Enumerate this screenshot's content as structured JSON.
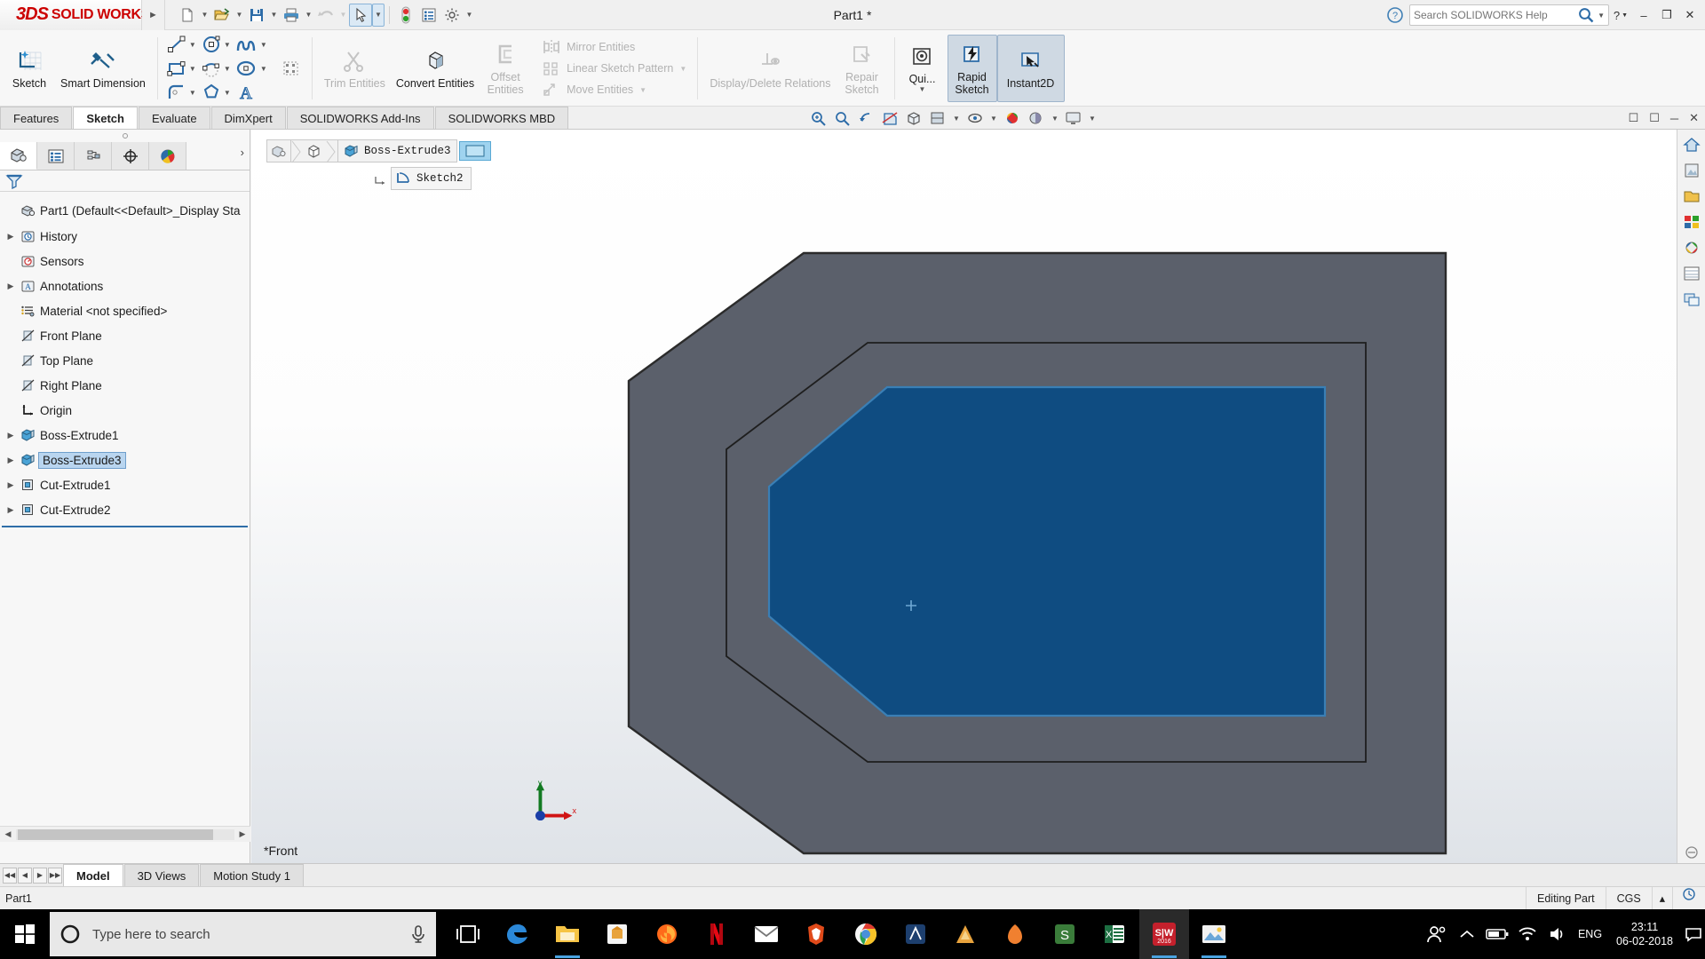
{
  "titlebar": {
    "brand_3ds": "3DS",
    "brand_solid": "SOLID",
    "brand_works": "WORKS",
    "doc_title": "Part1 *",
    "search_placeholder": "Search SOLIDWORKS Help",
    "help_label": "?",
    "minimize": "–",
    "maximize": "❐",
    "close": "✕",
    "quick_access": [
      {
        "name": "new-document-icon",
        "caret": true
      },
      {
        "name": "open-document-icon",
        "caret": true
      },
      {
        "name": "save-icon",
        "caret": true
      },
      {
        "name": "print-icon",
        "caret": true
      },
      {
        "name": "undo-icon",
        "caret": true
      },
      {
        "name": "select-cursor-icon",
        "caret": true,
        "selected": true
      },
      {
        "name": "rebuild-icon",
        "caret": false
      },
      {
        "name": "options-list-icon",
        "caret": false
      },
      {
        "name": "settings-gear-icon",
        "caret": true
      }
    ]
  },
  "ribbon": {
    "sketch_label": "Sketch",
    "smart_dimension_label": "Smart Dimension",
    "trim_entities_label": "Trim Entities",
    "convert_entities_label": "Convert Entities",
    "offset_entities_label": "Offset\nEntities",
    "offset_line1": "Offset",
    "offset_line2": "Entities",
    "mirror_entities_label": "Mirror Entities",
    "linear_sketch_pattern_label": "Linear Sketch Pattern",
    "move_entities_label": "Move Entities",
    "display_delete_relations_label": "Display/Delete Relations",
    "repair_sketch_line1": "Repair",
    "repair_sketch_line2": "Sketch",
    "quick_snaps_label": "Qui...",
    "rapid_sketch_line1": "Rapid",
    "rapid_sketch_line2": "Sketch",
    "instant2d_label": "Instant2D"
  },
  "tabs": [
    {
      "label": "Features",
      "active": false
    },
    {
      "label": "Sketch",
      "active": true
    },
    {
      "label": "Evaluate",
      "active": false
    },
    {
      "label": "DimXpert",
      "active": false
    },
    {
      "label": "SOLIDWORKS Add-Ins",
      "active": false
    },
    {
      "label": "SOLIDWORKS MBD",
      "active": false
    }
  ],
  "hud_icons": [
    "zoom-to-fit-icon",
    "zoom-to-area-icon",
    "previous-view-icon",
    "section-view-icon",
    "view-orientation-icon",
    "display-style-icon",
    "hide-show-items-icon",
    "edit-appearance-icon",
    "apply-scene-icon",
    "view-settings-icon"
  ],
  "window_controls_view": [
    "restore-down-icon",
    "maximize-view-icon",
    "minimize-view-icon",
    "close-view-icon"
  ],
  "left_panel": {
    "tabs": [
      {
        "name": "feature-manager-tab",
        "active": true
      },
      {
        "name": "property-manager-tab",
        "active": false
      },
      {
        "name": "configuration-manager-tab",
        "active": false
      },
      {
        "name": "dimxpert-manager-tab",
        "active": false
      },
      {
        "name": "display-manager-tab",
        "active": false
      }
    ],
    "expand_chevron": "›",
    "filter_placeholder": "",
    "tree": [
      {
        "label": "Part1  (Default<<Default>_Display Sta",
        "icon": "part-icon",
        "arrow": false,
        "indent": 0,
        "selected": false
      },
      {
        "label": "History",
        "icon": "history-icon",
        "arrow": true,
        "indent": 1,
        "selected": false
      },
      {
        "label": "Sensors",
        "icon": "sensors-icon",
        "arrow": false,
        "indent": 1,
        "selected": false
      },
      {
        "label": "Annotations",
        "icon": "annotations-icon",
        "arrow": true,
        "indent": 1,
        "selected": false
      },
      {
        "label": "Material <not specified>",
        "icon": "material-icon",
        "arrow": false,
        "indent": 1,
        "selected": false
      },
      {
        "label": "Front Plane",
        "icon": "plane-icon",
        "arrow": false,
        "indent": 1,
        "selected": false
      },
      {
        "label": "Top Plane",
        "icon": "plane-icon",
        "arrow": false,
        "indent": 1,
        "selected": false
      },
      {
        "label": "Right Plane",
        "icon": "plane-icon",
        "arrow": false,
        "indent": 1,
        "selected": false
      },
      {
        "label": "Origin",
        "icon": "origin-icon",
        "arrow": false,
        "indent": 1,
        "selected": false
      },
      {
        "label": "Boss-Extrude1",
        "icon": "boss-extrude-icon",
        "arrow": true,
        "indent": 1,
        "selected": false
      },
      {
        "label": "Boss-Extrude3",
        "icon": "boss-extrude-icon",
        "arrow": true,
        "indent": 1,
        "selected": true
      },
      {
        "label": "Cut-Extrude1",
        "icon": "cut-extrude-icon",
        "arrow": true,
        "indent": 1,
        "selected": false
      },
      {
        "label": "Cut-Extrude2",
        "icon": "cut-extrude-icon",
        "arrow": true,
        "indent": 1,
        "selected": false
      }
    ]
  },
  "viewport": {
    "breadcrumb_feature": "Boss-Extrude3",
    "sketch_chip": "Sketch2",
    "view_label": "*Front",
    "triad_x": "x",
    "triad_y": "y",
    "colors": {
      "body_fill": "#5b606b",
      "body_edge": "#2b2b2b",
      "face_fill": "#0f4c81",
      "face_edge": "#3a7fb5",
      "origin_blue": "#1a3ea8",
      "axis_green": "#127a22",
      "axis_red": "#d01414"
    }
  },
  "rail_icons": [
    "view-home-icon",
    "appearances-icon",
    "scenes-icon",
    "decals-icon",
    "lights-cameras-icon",
    "display-states-icon",
    "custom-views-icon"
  ],
  "bottom_tabs": [
    {
      "label": "Model",
      "active": true
    },
    {
      "label": "3D Views",
      "active": false
    },
    {
      "label": "Motion Study 1",
      "active": false
    }
  ],
  "statusbar": {
    "left": "Part1",
    "editing": "Editing Part",
    "units": "CGS",
    "caret": "▴"
  },
  "taskbar": {
    "search_placeholder": "Type here to search",
    "language": "ENG",
    "time": "23:11",
    "date": "06-02-2018",
    "apps": [
      "task-view-icon",
      "edge-browser-icon",
      "file-explorer-icon",
      "microsoft-store-icon",
      "firefox-icon",
      "netflix-icon",
      "mail-icon",
      "brave-icon",
      "chrome-icon",
      "autocad-icon",
      "ansys-icon",
      "app-orange-icon",
      "snagit-icon",
      "excel-icon",
      "solidworks-icon",
      "photos-icon"
    ]
  }
}
